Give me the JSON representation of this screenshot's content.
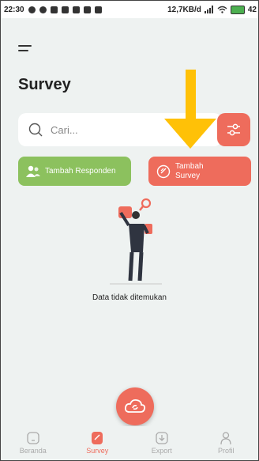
{
  "statusbar": {
    "time": "22:30",
    "net": "12,7KB/d",
    "battery": "42"
  },
  "page": {
    "title": "Survey"
  },
  "search": {
    "placeholder": "Cari..."
  },
  "actions": {
    "add_respondent": "Tambah Responden",
    "add_survey_line1": "Tambah",
    "add_survey_line2": "Survey"
  },
  "empty": {
    "message": "Data tidak ditemukan"
  },
  "nav": {
    "items": [
      {
        "label": "Beranda",
        "icon": "home-icon"
      },
      {
        "label": "Survey",
        "icon": "survey-icon"
      },
      {
        "label": "Export",
        "icon": "export-icon"
      },
      {
        "label": "Profil",
        "icon": "profile-icon"
      }
    ],
    "active": "Survey"
  },
  "colors": {
    "primary": "#ee6c5c",
    "green": "#8cc15e",
    "arrow": "#ffc107",
    "background": "#eef2f1"
  }
}
